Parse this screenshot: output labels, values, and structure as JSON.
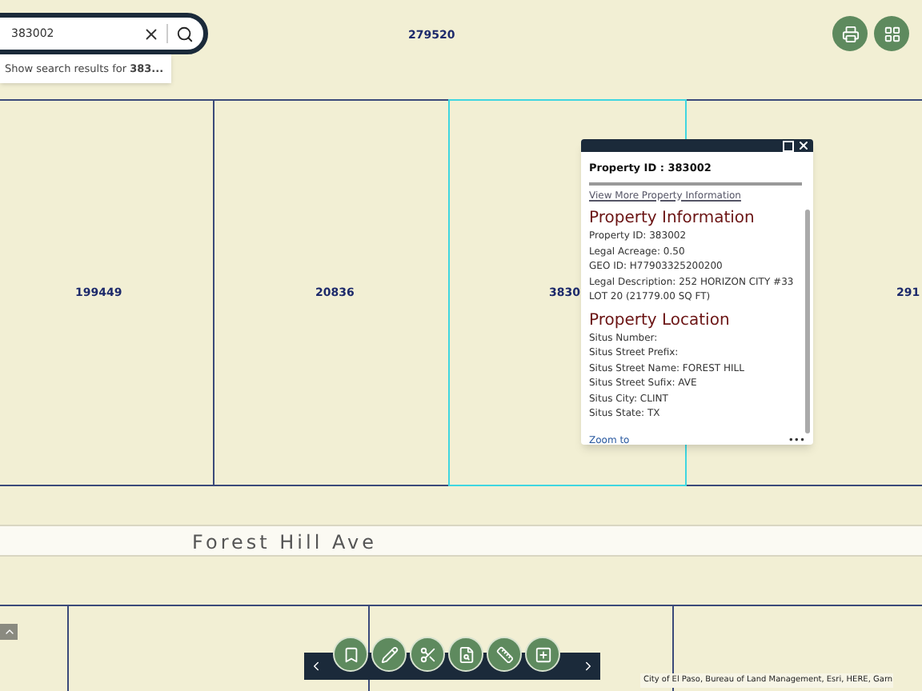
{
  "search": {
    "value": "383002",
    "suggestion": "Show search results for **383...**"
  },
  "map": {
    "parcel_labels": [
      "279520",
      "199449",
      "20836",
      "3830",
      "291"
    ],
    "road_label": "Forest Hill Ave",
    "attribution": "City of El Paso, Bureau of Land Management, Esri, HERE, Garn"
  },
  "popup": {
    "title": "Property ID : 383002",
    "link": "View More Property Information",
    "sections": [
      {
        "heading": "Property Information",
        "lines": [
          "Property ID: 383002",
          "Legal Acreage: 0.50",
          "GEO ID: H77903325200200",
          "Legal Description: 252 HORIZON CITY #33 LOT 20 (21779.00 SQ FT)"
        ]
      },
      {
        "heading": "Property Location",
        "lines": [
          "Situs Number:",
          "Situs Street Prefix:",
          "Situs Street Name: FOREST HILL",
          "Situs Street Sufix: AVE",
          "Situs City: CLINT",
          "Situs State: TX"
        ]
      }
    ],
    "footer_link": "Zoom to",
    "more": "•••"
  }
}
